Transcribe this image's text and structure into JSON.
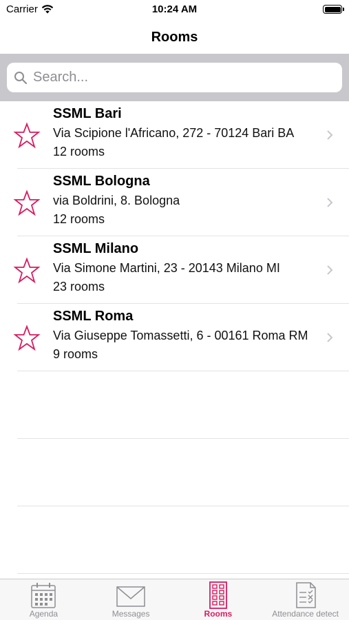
{
  "status_bar": {
    "carrier": "Carrier",
    "time": "10:24 AM"
  },
  "nav": {
    "title": "Rooms"
  },
  "search": {
    "placeholder": "Search..."
  },
  "rooms": [
    {
      "name": "SSML Bari",
      "address": "Via Scipione l'Africano, 272 - 70124 Bari BA",
      "count": "12 rooms"
    },
    {
      "name": "SSML Bologna",
      "address": "via Boldrini, 8. Bologna",
      "count": "12 rooms"
    },
    {
      "name": "SSML Milano",
      "address": "Via Simone Martini, 23 - 20143 Milano MI",
      "count": "23 rooms"
    },
    {
      "name": "SSML Roma",
      "address": "Via Giuseppe Tomassetti, 6 - 00161 Roma RM",
      "count": "9 rooms"
    }
  ],
  "tabs": [
    {
      "label": "Agenda",
      "icon": "calendar-icon",
      "active": false
    },
    {
      "label": "Messages",
      "icon": "envelope-icon",
      "active": false
    },
    {
      "label": "Rooms",
      "icon": "building-icon",
      "active": true
    },
    {
      "label": "Attendance detect",
      "icon": "checklist-icon",
      "active": false
    }
  ],
  "colors": {
    "accent": "#d81b60",
    "inactive": "#8e8e93",
    "search_bg": "#c8c7cc"
  }
}
